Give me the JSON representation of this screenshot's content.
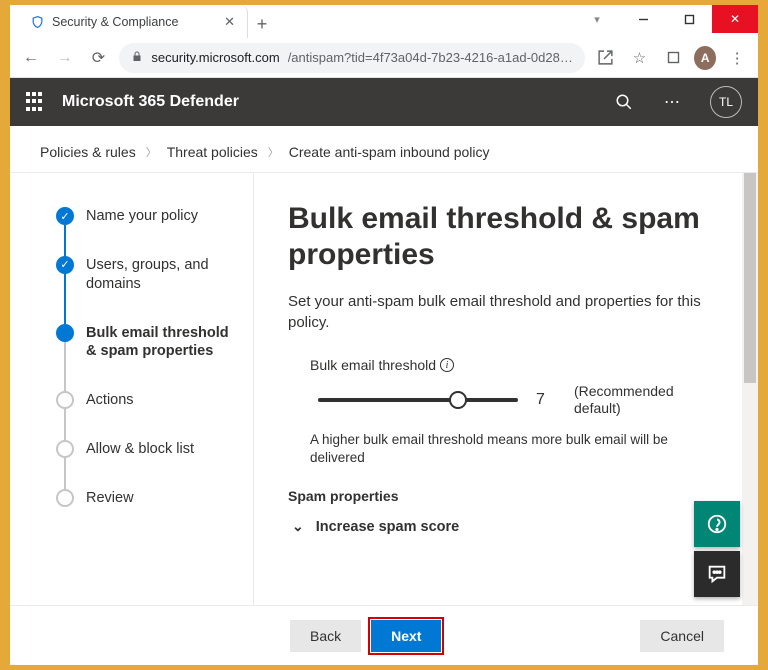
{
  "tab": {
    "title": "Security & Compliance"
  },
  "url": {
    "host": "security.microsoft.com",
    "path": "/antispam?tid=4f73a04d-7b23-4216-a1ad-0d28…"
  },
  "avatar_small": "A",
  "defender": {
    "title": "Microsoft 365 Defender",
    "avatar": "TL"
  },
  "breadcrumb": {
    "a": "Policies & rules",
    "b": "Threat policies",
    "c": "Create anti-spam inbound policy"
  },
  "steps": [
    {
      "label": "Name your policy"
    },
    {
      "label": "Users, groups, and domains"
    },
    {
      "label": "Bulk email threshold & spam properties"
    },
    {
      "label": "Actions"
    },
    {
      "label": "Allow & block list"
    },
    {
      "label": "Review"
    }
  ],
  "content": {
    "heading": "Bulk email threshold & spam properties",
    "sub": "Set your anti-spam bulk email threshold and properties for this policy.",
    "threshold_label": "Bulk email threshold",
    "threshold_value": "7",
    "threshold_hint": "(Recommended default)",
    "threshold_help": "A higher bulk email threshold means more bulk email will be delivered",
    "spam_section": "Spam properties",
    "expander1": "Increase spam score"
  },
  "buttons": {
    "back": "Back",
    "next": "Next",
    "cancel": "Cancel"
  }
}
